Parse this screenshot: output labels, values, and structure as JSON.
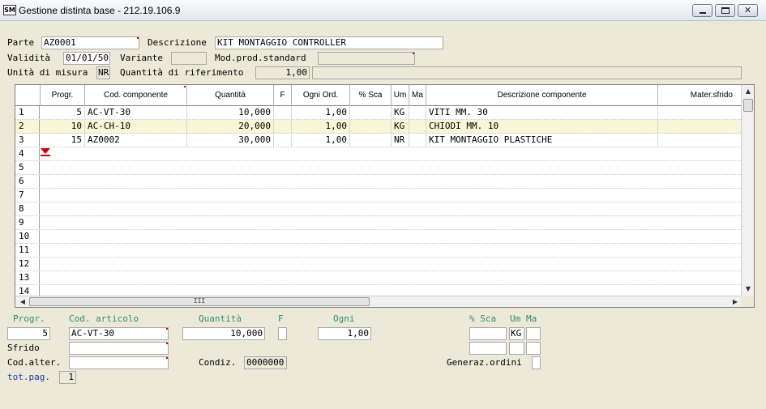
{
  "window": {
    "logo": "SM",
    "title": "Gestione distinta base   -  212.19.106.9",
    "min_icon": "minimize-icon",
    "max_icon": "maximize-icon",
    "close_icon": "close-icon",
    "close_glyph": "✕"
  },
  "header": {
    "parte_label": "Parte",
    "parte_value": "AZ0001",
    "descrizione_label": "Descrizione",
    "descrizione_value": "KIT MONTAGGIO CONTROLLER",
    "validita_label": "Validità",
    "validita_value": "01/01/50",
    "variante_label": "Variante",
    "variante_value": "",
    "mod_prod_label": "Mod.prod.standard",
    "mod_prod_value": "",
    "unita_label": "Unità di misura",
    "unita_value": "NR",
    "quantita_rif_label": "Quantità di riferimento",
    "quantita_rif_value": "1,00",
    "extra_value": ""
  },
  "grid": {
    "columns": [
      "Progr.",
      "Cod. componente",
      "Quantità",
      "F",
      "Ogni Ord.",
      "% Sca",
      "Um",
      "Ma",
      "Descrizione componente",
      "Mater.sfrido"
    ],
    "rows": [
      {
        "n": "1",
        "progr": "5",
        "cod": "AC-VT-30",
        "qta": "10,000",
        "f": "",
        "ogni": "1,00",
        "sca": "",
        "um": "KG",
        "ma": "",
        "desc": "VITI MM. 30",
        "sfrido": ""
      },
      {
        "n": "2",
        "progr": "10",
        "cod": "AC-CH-10",
        "qta": "20,000",
        "f": "",
        "ogni": "1,00",
        "sca": "",
        "um": "KG",
        "ma": "",
        "desc": "CHIODI MM. 10",
        "sfrido": ""
      },
      {
        "n": "3",
        "progr": "15",
        "cod": "AZ0002",
        "qta": "30,000",
        "f": "",
        "ogni": "1,00",
        "sca": "",
        "um": "NR",
        "ma": "",
        "desc": "KIT MONTAGGIO PLASTICHE",
        "sfrido": ""
      }
    ],
    "empty_rows": [
      "4",
      "5",
      "6",
      "7",
      "8",
      "9",
      "10",
      "11",
      "12",
      "13",
      "14"
    ],
    "hscroll_grip": "III",
    "arrows": {
      "up": "▲",
      "down": "▼",
      "left": "◀",
      "right": "▶"
    }
  },
  "detail": {
    "progr_label": "Progr.",
    "cod_label": "Cod. articolo",
    "qta_label": "Quantità",
    "f_label": "F",
    "ogni_label": "Ogni",
    "sca_label": "% Sca",
    "um_label": "Um",
    "ma_label": "Ma",
    "progr_value": "5",
    "cod_value": "AC-VT-30",
    "qta_value": "10,000",
    "f_value": "",
    "ogni_value": "1,00",
    "sca_value": "",
    "um_value": "KG",
    "ma_value": "",
    "sfrido_label": "Sfrido",
    "sfrido_value": "",
    "cod_alter_label": "Cod.alter.",
    "cod_alter_value": "",
    "condiz_label": "Condiz.",
    "condiz_value": "0000000",
    "generaz_label": "Generaz.ordini",
    "generaz_value": "",
    "totpag_label": "tot.pag.",
    "totpag_value": "1"
  }
}
